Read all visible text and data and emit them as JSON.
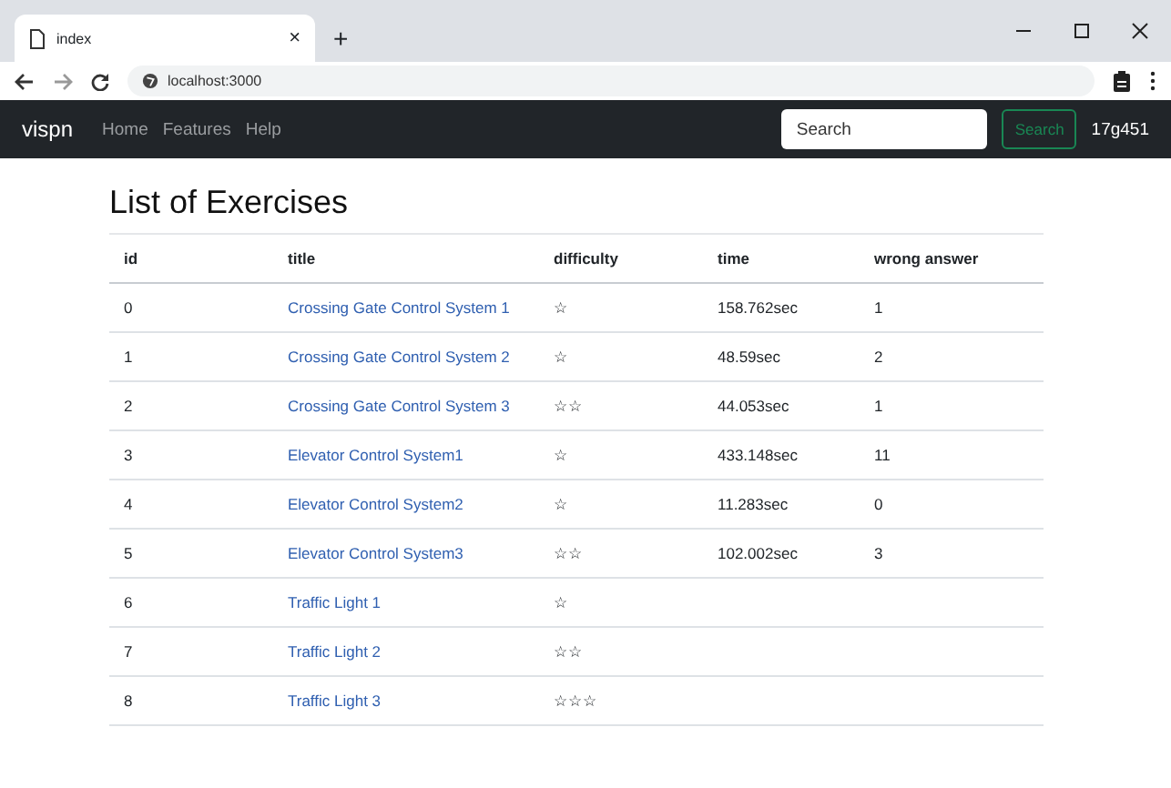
{
  "browser": {
    "tab_title": "index",
    "tab_close": "×",
    "new_tab": "+",
    "url": "localhost:3000"
  },
  "navbar": {
    "brand": "vispn",
    "links": [
      "Home",
      "Features",
      "Help"
    ],
    "search": {
      "placeholder": "Search"
    },
    "search_button": "Search",
    "user": "17g451"
  },
  "page": {
    "heading": "List of Exercises"
  },
  "table": {
    "columns": [
      "id",
      "title",
      "difficulty",
      "time",
      "wrong answer"
    ],
    "rows": [
      {
        "id": "0",
        "title": "Crossing Gate Control System 1",
        "difficulty": "☆",
        "time": "158.762sec",
        "wrong_answer": "1"
      },
      {
        "id": "1",
        "title": "Crossing Gate Control System 2",
        "difficulty": "☆",
        "time": "48.59sec",
        "wrong_answer": "2"
      },
      {
        "id": "2",
        "title": "Crossing Gate Control System 3",
        "difficulty": "☆☆",
        "time": "44.053sec",
        "wrong_answer": "1"
      },
      {
        "id": "3",
        "title": "Elevator Control System1",
        "difficulty": "☆",
        "time": "433.148sec",
        "wrong_answer": "11"
      },
      {
        "id": "4",
        "title": "Elevator Control System2",
        "difficulty": "☆",
        "time": "11.283sec",
        "wrong_answer": "0"
      },
      {
        "id": "5",
        "title": "Elevator Control System3",
        "difficulty": "☆☆",
        "time": "102.002sec",
        "wrong_answer": "3"
      },
      {
        "id": "6",
        "title": "Traffic Light 1",
        "difficulty": "☆"
      },
      {
        "id": "7",
        "title": "Traffic Light 2",
        "difficulty": "☆☆"
      },
      {
        "id": "8",
        "title": "Traffic Light 3",
        "difficulty": "☆☆☆"
      }
    ]
  }
}
